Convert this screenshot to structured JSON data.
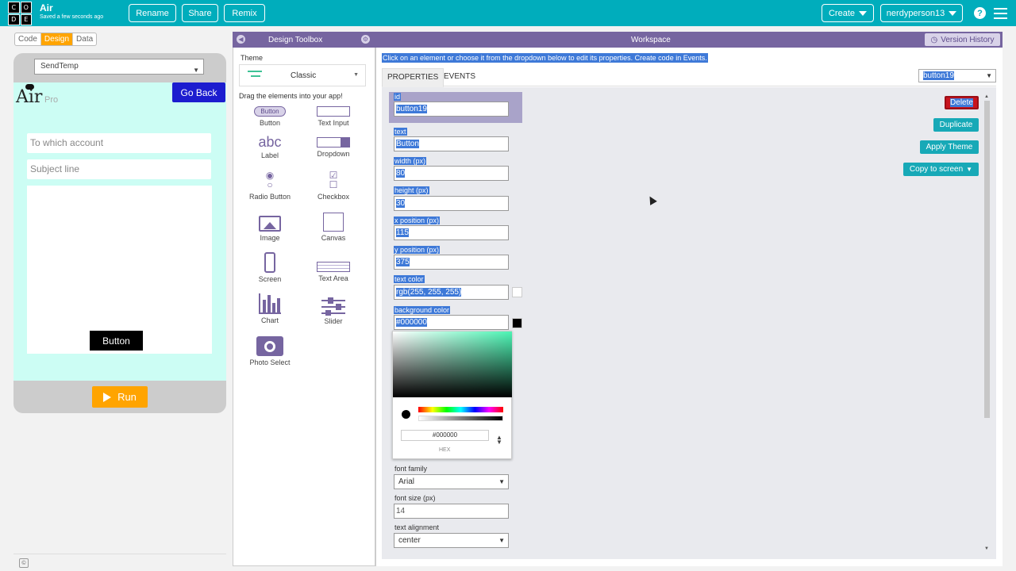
{
  "header": {
    "logo_letters": [
      "C",
      "O",
      "D",
      "E"
    ],
    "app_name": "Air",
    "saved_status": "Saved a few seconds ago",
    "rename_label": "Rename",
    "share_label": "Share",
    "remix_label": "Remix",
    "create_label": "Create",
    "user_label": "nerdyperson13",
    "help_glyph": "?",
    "icons": [
      "help-icon",
      "menu-icon",
      "caret-down-icon"
    ]
  },
  "mode_tabs": [
    "Code",
    "Design",
    "Data"
  ],
  "mode_active": "Design",
  "app_preview": {
    "screen_select": "SendTemp",
    "logo_text": "Air",
    "pro_text": "Pro",
    "go_back_label": "Go Back",
    "account_placeholder": "To which account",
    "subject_placeholder": "Subject line",
    "button_label": "Button",
    "run_label": "Run",
    "colors": {
      "screen_bg": "#ccfdf4",
      "go_back_bg": "#1c1ccf",
      "run_bg": "#ffa400"
    }
  },
  "toolbox": {
    "title": "Design Toolbox",
    "theme_label": "Theme",
    "theme_value": "Classic",
    "drag_hint": "Drag the elements into your app!",
    "button_icon_text": "Button",
    "label_icon_text": "abc",
    "tools": [
      "Button",
      "Text Input",
      "Label",
      "Dropdown",
      "Radio Button",
      "Checkbox",
      "Image",
      "Canvas",
      "Screen",
      "Text Area",
      "Chart",
      "Slider",
      "Photo Select"
    ]
  },
  "workspace": {
    "title": "Workspace",
    "version_history_label": "Version History",
    "instructions": "Click on an element or choose it from the dropdown below to edit its properties. Create code in Events.",
    "tab_properties": "PROPERTIES",
    "tab_events": "EVENTS",
    "element_select": "button19",
    "delete_label": "Delete",
    "duplicate_label": "Duplicate",
    "apply_theme_label": "Apply Theme",
    "copy_to_screen_label": "Copy to screen",
    "properties": {
      "id_label": "id",
      "id_value": "button19",
      "text_label": "text",
      "text_value": "Button",
      "width_label": "width (px)",
      "width_value": "80",
      "height_label": "height (px)",
      "height_value": "30",
      "x_label": "x position (px)",
      "x_value": "115",
      "y_label": "y position (px)",
      "y_value": "375",
      "text_color_label": "text color",
      "text_color_value": "rgb(255, 255, 255)",
      "bg_color_label": "background color",
      "bg_color_value": "#000000",
      "font_family_label": "font family",
      "font_family_value": "Arial",
      "font_size_label": "font size (px)",
      "font_size_value": "14",
      "text_align_label": "text alignment",
      "text_align_value": "center"
    },
    "picker": {
      "hex_value": "#000000",
      "hex_label": "HEX"
    },
    "colors": {
      "header_bg": "#7665a0",
      "selection": "#3e79d8",
      "delete_bg": "#c8141e",
      "action_bg": "#17a9b7"
    }
  }
}
